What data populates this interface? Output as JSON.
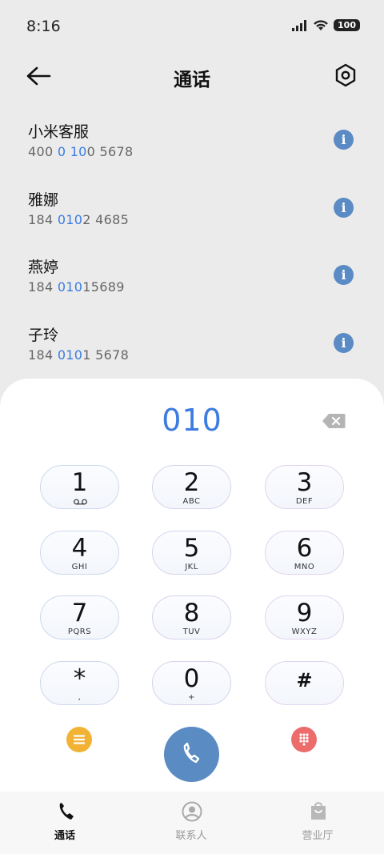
{
  "status": {
    "time": "8:16",
    "battery": "100"
  },
  "header": {
    "title": "通话"
  },
  "contacts": [
    {
      "name": "小米客服",
      "number_pre": "400 ",
      "number_hl1": "0",
      "number_mid": " ",
      "number_hl2": "10",
      "number_post": "0 5678"
    },
    {
      "name": "雅娜",
      "number_pre": "184 ",
      "number_hl1": "010",
      "number_mid": "",
      "number_hl2": "",
      "number_post": "2 4685"
    },
    {
      "name": "燕婷",
      "number_pre": "184 ",
      "number_hl1": "010",
      "number_mid": "",
      "number_hl2": "",
      "number_post": "15689"
    },
    {
      "name": "子玲",
      "number_pre": "184 ",
      "number_hl1": "010",
      "number_mid": "",
      "number_hl2": "",
      "number_post": "1 5678"
    }
  ],
  "dialer": {
    "input": "010",
    "keys": [
      {
        "digit": "1",
        "letters": ""
      },
      {
        "digit": "2",
        "letters": "ABC"
      },
      {
        "digit": "3",
        "letters": "DEF"
      },
      {
        "digit": "4",
        "letters": "GHI"
      },
      {
        "digit": "5",
        "letters": "JKL"
      },
      {
        "digit": "6",
        "letters": "MNO"
      },
      {
        "digit": "7",
        "letters": "PQRS"
      },
      {
        "digit": "8",
        "letters": "TUV"
      },
      {
        "digit": "9",
        "letters": "WXYZ"
      },
      {
        "digit": "*",
        "letters": ","
      },
      {
        "digit": "0",
        "letters": "+"
      },
      {
        "digit": "#",
        "letters": ""
      }
    ]
  },
  "nav": {
    "calls": "通话",
    "contacts": "联系人",
    "store": "营业厅"
  },
  "colors": {
    "accent": "#3c7ce0",
    "call_button": "#5a8bc2",
    "menu_button": "#f2b335",
    "keypad_toggle": "#ec6c6c"
  },
  "icons": [
    "back-arrow-icon",
    "settings-icon",
    "info-icon",
    "backspace-icon",
    "voicemail-icon",
    "menu-icon",
    "keypad-grid-icon",
    "phone-icon",
    "contacts-icon",
    "store-bag-icon"
  ]
}
